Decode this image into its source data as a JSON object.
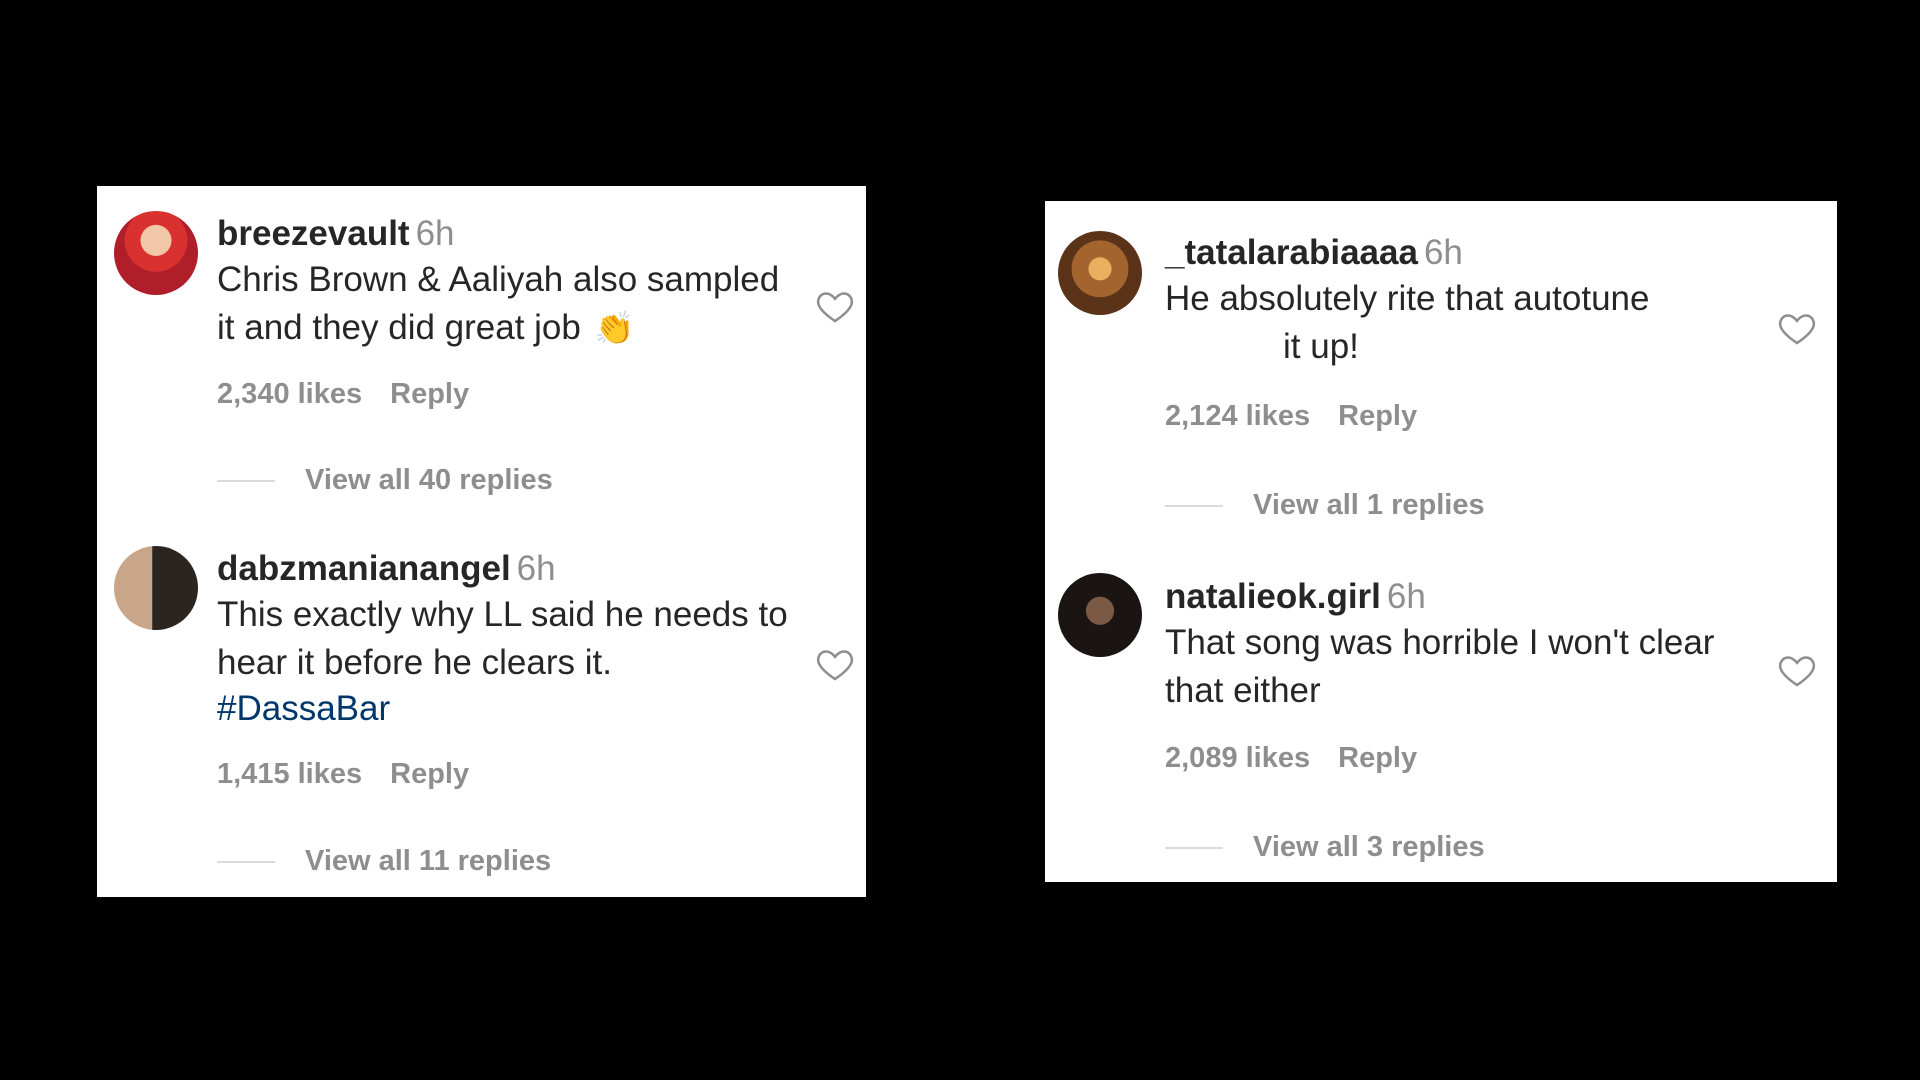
{
  "panels": [
    {
      "comments": [
        {
          "username": "breezevault",
          "time": "6h",
          "text_lines": [
            "Chris Brown & Aaliyah also sampled",
            "it and they did great job"
          ],
          "emoji": "👏",
          "likes": "2,340 likes",
          "reply": "Reply",
          "view_replies": "View all 40 replies"
        },
        {
          "username": "dabzmanianangel",
          "time": "6h",
          "text_lines": [
            "This exactly why LL said he needs to",
            "hear it before he clears it."
          ],
          "hashtag": "#DassaBar",
          "likes": "1,415 likes",
          "reply": "Reply",
          "view_replies": "View all 11 replies"
        }
      ]
    },
    {
      "comments": [
        {
          "username": "_tatalarabiaaaa",
          "time": "6h",
          "text_lines": [
            "He absolutely rite that autotune",
            "it up!"
          ],
          "likes": "2,124 likes",
          "reply": "Reply",
          "view_replies": "View all 1 replies"
        },
        {
          "username": "natalieok.girl",
          "time": "6h",
          "text_lines": [
            "That song was horrible I won't clear",
            "that either"
          ],
          "likes": "2,089 likes",
          "reply": "Reply",
          "view_replies": "View all 3 replies"
        }
      ]
    }
  ]
}
